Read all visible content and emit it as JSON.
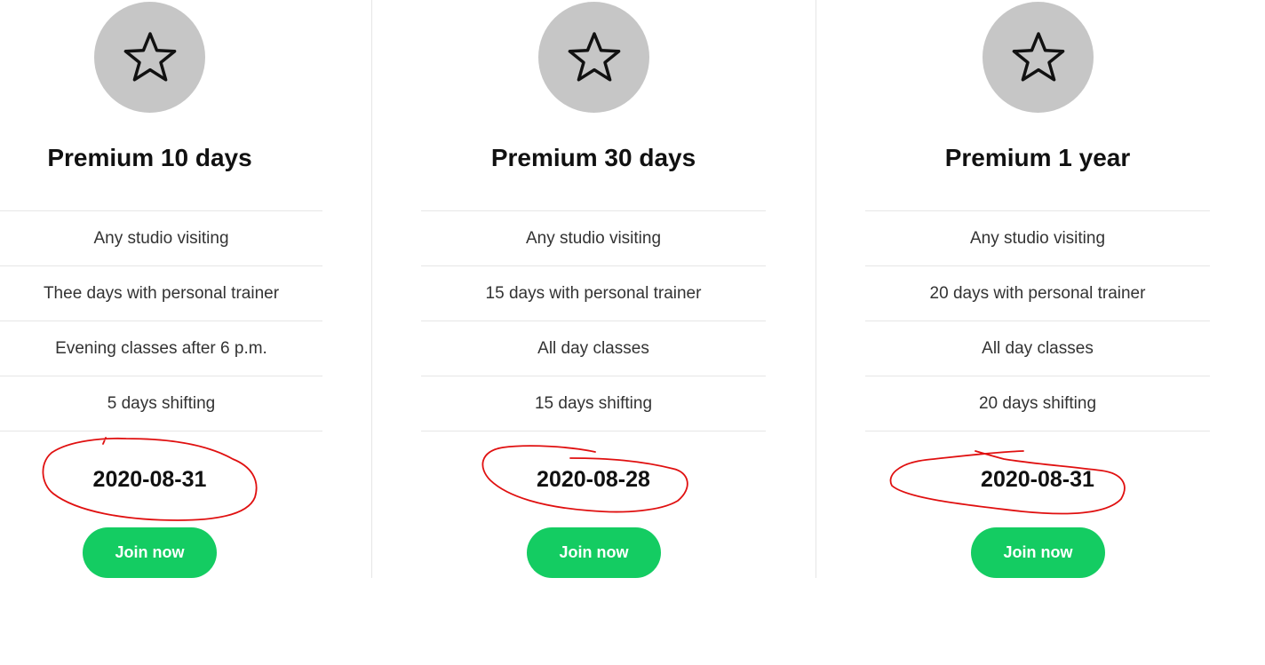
{
  "colors": {
    "icon_circle": "#c6c6c6",
    "button_bg": "#14cc62",
    "button_text": "#ffffff",
    "divider": "#e6e6e6",
    "annotation": "#e01010"
  },
  "plans": [
    {
      "icon": "star-icon",
      "title": "Premium 10 days",
      "features": [
        "Any studio visiting",
        "Thee days with personal trainer",
        "Evening classes after 6 p.m.",
        "5 days shifting"
      ],
      "date": "2020-08-31",
      "button_label": "Join now"
    },
    {
      "icon": "star-icon",
      "title": "Premium 30 days",
      "features": [
        "Any studio visiting",
        "15 days with personal trainer",
        "All day classes",
        "15 days shifting"
      ],
      "date": "2020-08-28",
      "button_label": "Join now"
    },
    {
      "icon": "star-icon",
      "title": "Premium 1 year",
      "features": [
        "Any studio visiting",
        "20 days with personal trainer",
        "All day classes",
        "20 days shifting"
      ],
      "date": "2020-08-31",
      "button_label": "Join now"
    }
  ]
}
